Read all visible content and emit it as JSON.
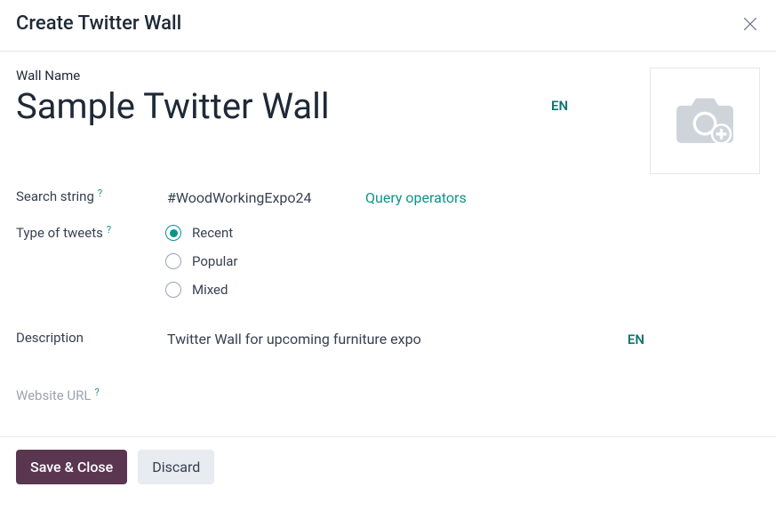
{
  "dialog": {
    "title": "Create Twitter Wall"
  },
  "wall_name": {
    "label": "Wall Name",
    "value": "Sample Twitter Wall",
    "lang_badge": "EN"
  },
  "search_string": {
    "label": "Search string",
    "value": "#WoodWorkingExpo24",
    "query_operators_link": "Query operators"
  },
  "type_of_tweets": {
    "label": "Type of tweets",
    "selected": "recent",
    "options": {
      "recent": "Recent",
      "popular": "Popular",
      "mixed": "Mixed"
    }
  },
  "description": {
    "label": "Description",
    "value": "Twitter Wall for upcoming furniture expo",
    "lang_badge": "EN"
  },
  "website_url": {
    "label": "Website URL"
  },
  "footer": {
    "save_label": "Save & Close",
    "discard_label": "Discard"
  },
  "icons": {
    "close": "close-icon",
    "camera_plus": "camera-plus-icon",
    "help": "?"
  }
}
